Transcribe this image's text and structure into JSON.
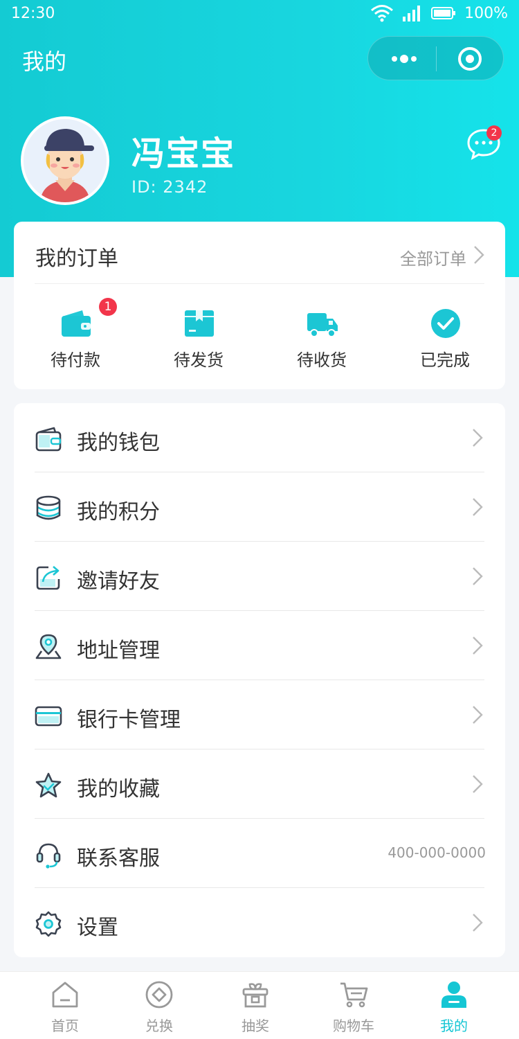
{
  "status_bar": {
    "time": "12:30",
    "battery": "100%"
  },
  "header": {
    "title": "我的"
  },
  "profile": {
    "name": "冯宝宝",
    "id_text": "ID: 2342",
    "message_count": "2"
  },
  "orders": {
    "title": "我的订单",
    "all_link": "全部订单",
    "items": [
      {
        "label": "待付款",
        "icon": "wallet-icon",
        "badge": "1"
      },
      {
        "label": "待发货",
        "icon": "package-icon"
      },
      {
        "label": "待收货",
        "icon": "truck-icon"
      },
      {
        "label": "已完成",
        "icon": "check-circle-icon"
      }
    ]
  },
  "menu": [
    {
      "label": "我的钱包",
      "icon": "wallet-icon"
    },
    {
      "label": "我的积分",
      "icon": "coins-icon"
    },
    {
      "label": "邀请好友",
      "icon": "share-icon"
    },
    {
      "label": "地址管理",
      "icon": "location-icon"
    },
    {
      "label": "银行卡管理",
      "icon": "bank-card-icon"
    },
    {
      "label": "我的收藏",
      "icon": "star-icon"
    },
    {
      "label": "联系客服",
      "icon": "headset-icon",
      "value": "400-000-0000"
    },
    {
      "label": "设置",
      "icon": "gear-icon"
    }
  ],
  "tabbar": [
    {
      "label": "首页",
      "icon": "home-icon"
    },
    {
      "label": "兑换",
      "icon": "exchange-icon"
    },
    {
      "label": "抽奖",
      "icon": "gift-icon"
    },
    {
      "label": "购物车",
      "icon": "cart-icon"
    },
    {
      "label": "我的",
      "icon": "user-icon",
      "active": true
    }
  ],
  "colors": {
    "accent": "#15c6d4",
    "badge": "#f2354a",
    "icon_dark": "#3a4250"
  }
}
